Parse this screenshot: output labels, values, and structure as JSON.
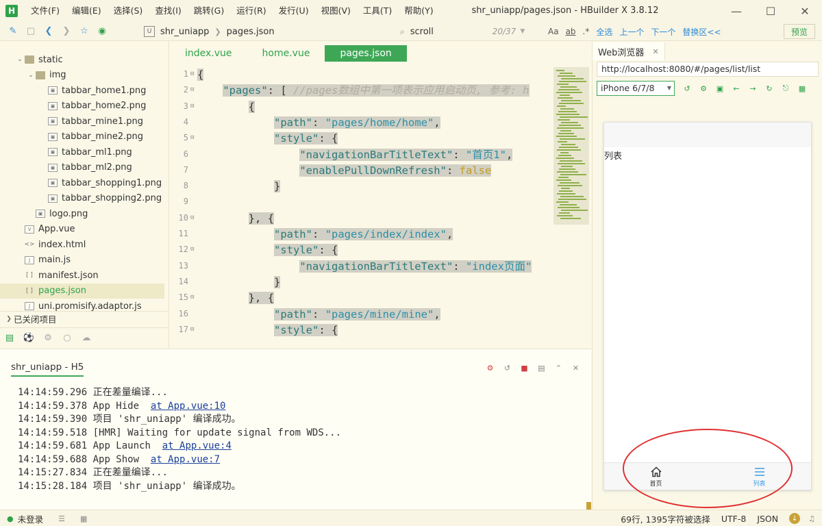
{
  "app": {
    "logo": "H",
    "window_title": "shr_uniapp/pages.json - HBuilder X 3.8.12",
    "menu": [
      "文件(F)",
      "编辑(E)",
      "选择(S)",
      "查找(I)",
      "跳转(G)",
      "运行(R)",
      "发行(U)",
      "视图(V)",
      "工具(T)",
      "帮助(Y)"
    ],
    "window_buttons": [
      "minimize-icon",
      "maximize-icon",
      "close-icon"
    ]
  },
  "toolbar": {
    "breadcrumb_badge": "U",
    "breadcrumb": [
      "shr_uniapp",
      "pages.json"
    ],
    "search_value": "scroll",
    "search_count": "20/37",
    "find_tools": [
      "Aa",
      "ab",
      ".*",
      "全选",
      "上一个",
      "下一个",
      "替换区<<"
    ],
    "preview_label": "预览"
  },
  "file_tree": {
    "items": [
      {
        "label": "static",
        "type": "folder",
        "level": 1,
        "expanded": true
      },
      {
        "label": "img",
        "type": "folder",
        "level": 2,
        "expanded": true
      },
      {
        "label": "tabbar_home1.png",
        "type": "image",
        "level": 3
      },
      {
        "label": "tabbar_home2.png",
        "type": "image",
        "level": 3
      },
      {
        "label": "tabbar_mine1.png",
        "type": "image",
        "level": 3
      },
      {
        "label": "tabbar_mine2.png",
        "type": "image",
        "level": 3
      },
      {
        "label": "tabbar_ml1.png",
        "type": "image",
        "level": 3
      },
      {
        "label": "tabbar_ml2.png",
        "type": "image",
        "level": 3
      },
      {
        "label": "tabbar_shopping1.png",
        "type": "image",
        "level": 3
      },
      {
        "label": "tabbar_shopping2.png",
        "type": "image",
        "level": 3
      },
      {
        "label": "logo.png",
        "type": "image",
        "level": 2
      },
      {
        "label": "App.vue",
        "type": "vue",
        "level": 1
      },
      {
        "label": "index.html",
        "type": "html",
        "level": 1
      },
      {
        "label": "main.js",
        "type": "js",
        "level": 1
      },
      {
        "label": "manifest.json",
        "type": "json",
        "level": 1
      },
      {
        "label": "pages.json",
        "type": "json",
        "level": 1,
        "active": true
      },
      {
        "label": "uni.promisify.adaptor.js",
        "type": "js",
        "level": 1
      }
    ],
    "closed_projects": "已关闭项目"
  },
  "editor": {
    "tabs": [
      {
        "label": "index.vue",
        "active": false
      },
      {
        "label": "home.vue",
        "active": false
      },
      {
        "label": "pages.json",
        "active": true
      }
    ],
    "line_numbers": [
      "1",
      "2",
      "3",
      "4",
      "5",
      "6",
      "7",
      "8",
      "9",
      "10",
      "11",
      "12",
      "13",
      "14",
      "15",
      "16",
      "17"
    ],
    "lines": [
      "{",
      "    \"pages\": [ //pages数组中第一项表示应用启动页, 参考: h",
      "        {",
      "            \"path\": \"pages/home/home\",",
      "            \"style\": {",
      "                \"navigationBarTitleText\": \"首页1\",",
      "                \"enablePullDownRefresh\": false",
      "            }",
      "",
      "        }, {",
      "            \"path\": \"pages/index/index\",",
      "            \"style\": {",
      "                \"navigationBarTitleText\": \"index页面\"",
      "            }",
      "        }, {",
      "            \"path\": \"pages/mine/mine\",",
      "            \"style\": {"
    ]
  },
  "browser": {
    "tab_label": "Web浏览器",
    "url": "http://localhost:8080/#/pages/list/list",
    "device": "iPhone 6/7/8",
    "tools": [
      "rotate-icon",
      "settings-icon",
      "screenshot-icon",
      "back-icon",
      "forward-icon",
      "refresh-icon",
      "lock-icon",
      "grid-icon"
    ],
    "phone_page_text": "列表",
    "tabbar": [
      {
        "label": "首页",
        "icon": "home-icon",
        "active": false
      },
      {
        "label": "列表",
        "icon": "list-icon",
        "active": true
      }
    ]
  },
  "console": {
    "tab_label": "shr_uniapp - H5",
    "logs": [
      {
        "time": "14:14:59.296",
        "text": "正在差量编译...",
        "link": ""
      },
      {
        "time": "14:14:59.378",
        "text": "App Hide  ",
        "link": "at App.vue:10"
      },
      {
        "time": "14:14:59.390",
        "text": "项目 'shr_uniapp' 编译成功。",
        "link": ""
      },
      {
        "time": "14:14:59.518",
        "text": "[HMR] Waiting for update signal from WDS...",
        "link": ""
      },
      {
        "time": "14:14:59.681",
        "text": "App Launch  ",
        "link": "at App.vue:4"
      },
      {
        "time": "14:14:59.688",
        "text": "App Show  ",
        "link": "at App.vue:7"
      },
      {
        "time": "14:15:27.834",
        "text": "正在差量编译...",
        "link": ""
      },
      {
        "time": "14:15:28.184",
        "text": "项目 'shr_uniapp' 编译成功。",
        "link": ""
      }
    ]
  },
  "statusbar": {
    "login": "未登录",
    "position": "69行, 1395字符被选择",
    "encoding": "UTF-8",
    "syntax": "JSON"
  },
  "colors": {
    "accent": "#3ea756",
    "background": "#fbf8e8",
    "highlight": "#d2d0c4",
    "annotation": "#e03030"
  }
}
